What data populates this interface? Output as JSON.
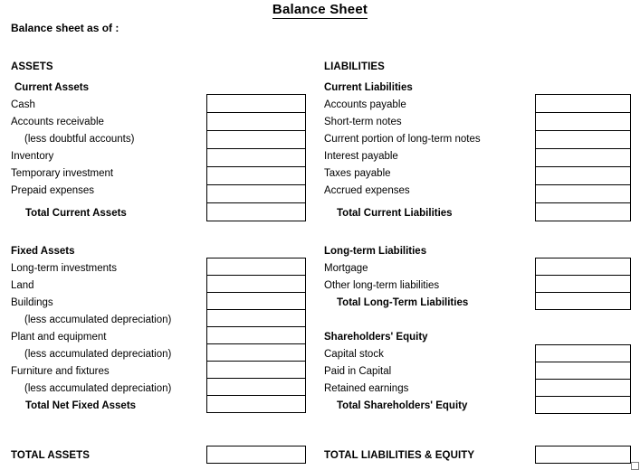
{
  "document": {
    "title": "Balance Sheet",
    "as_of_label": "Balance sheet as of :"
  },
  "left_column": {
    "heading": "ASSETS",
    "sections": [
      {
        "name": "current-assets",
        "heading": "Current Assets",
        "rows": [
          {
            "label": "Cash",
            "style": "normal",
            "value": ""
          },
          {
            "label": "Accounts receivable",
            "style": "normal",
            "value": ""
          },
          {
            "label": "(less doubtful accounts)",
            "style": "indent",
            "value": ""
          },
          {
            "label": "Inventory",
            "style": "normal",
            "value": ""
          },
          {
            "label": "Temporary investment",
            "style": "normal",
            "value": ""
          },
          {
            "label": "Prepaid expenses",
            "style": "normal",
            "value": ""
          },
          {
            "label": "Total Current Assets",
            "style": "total",
            "value": ""
          }
        ]
      },
      {
        "name": "fixed-assets",
        "heading": "Fixed Assets",
        "rows": [
          {
            "label": "Long-term investments",
            "style": "normal",
            "value": ""
          },
          {
            "label": "Land",
            "style": "normal",
            "value": ""
          },
          {
            "label": "Buildings",
            "style": "normal",
            "value": ""
          },
          {
            "label": "(less accumulated depreciation)",
            "style": "indent",
            "value": ""
          },
          {
            "label": "Plant and equipment",
            "style": "normal",
            "value": ""
          },
          {
            "label": "(less accumulated depreciation)",
            "style": "indent",
            "value": ""
          },
          {
            "label": "Furniture and fixtures",
            "style": "normal",
            "value": ""
          },
          {
            "label": "(less accumulated depreciation)",
            "style": "indent",
            "value": ""
          },
          {
            "label": "Total Net Fixed Assets",
            "style": "total",
            "value": ""
          }
        ]
      }
    ],
    "grand_total": {
      "label": "TOTAL ASSETS",
      "value": ""
    }
  },
  "right_column": {
    "heading": "LIABILITIES",
    "sections": [
      {
        "name": "current-liabilities",
        "heading": "Current Liabilities",
        "rows": [
          {
            "label": "Accounts payable",
            "style": "normal",
            "value": ""
          },
          {
            "label": "Short-term notes",
            "style": "normal",
            "value": ""
          },
          {
            "label": "Current portion of long-term notes",
            "style": "normal",
            "value": ""
          },
          {
            "label": "Interest payable",
            "style": "normal",
            "value": ""
          },
          {
            "label": "Taxes payable",
            "style": "normal",
            "value": ""
          },
          {
            "label": "Accrued expenses",
            "style": "normal",
            "value": ""
          },
          {
            "label": "Total Current Liabilities",
            "style": "total",
            "value": ""
          }
        ]
      },
      {
        "name": "long-term-liabilities",
        "heading": "Long-term Liabilities",
        "rows": [
          {
            "label": "Mortgage",
            "style": "normal",
            "value": ""
          },
          {
            "label": "Other long-term liabilities",
            "style": "normal",
            "value": ""
          },
          {
            "label": "Total Long-Term Liabilities",
            "style": "total",
            "value": ""
          }
        ]
      },
      {
        "name": "shareholders-equity",
        "heading": "Shareholders' Equity",
        "rows": [
          {
            "label": "Capital stock",
            "style": "normal",
            "value": ""
          },
          {
            "label": "Paid in Capital",
            "style": "normal",
            "value": ""
          },
          {
            "label": "Retained earnings",
            "style": "normal",
            "value": ""
          },
          {
            "label": "Total Shareholders' Equity",
            "style": "total",
            "value": ""
          }
        ]
      }
    ],
    "grand_total": {
      "label": "TOTAL LIABILITIES & EQUITY",
      "value": ""
    }
  },
  "colors": {
    "text": "#000000",
    "border": "#000000",
    "background": "#ffffff",
    "handle_border": "#808080"
  }
}
